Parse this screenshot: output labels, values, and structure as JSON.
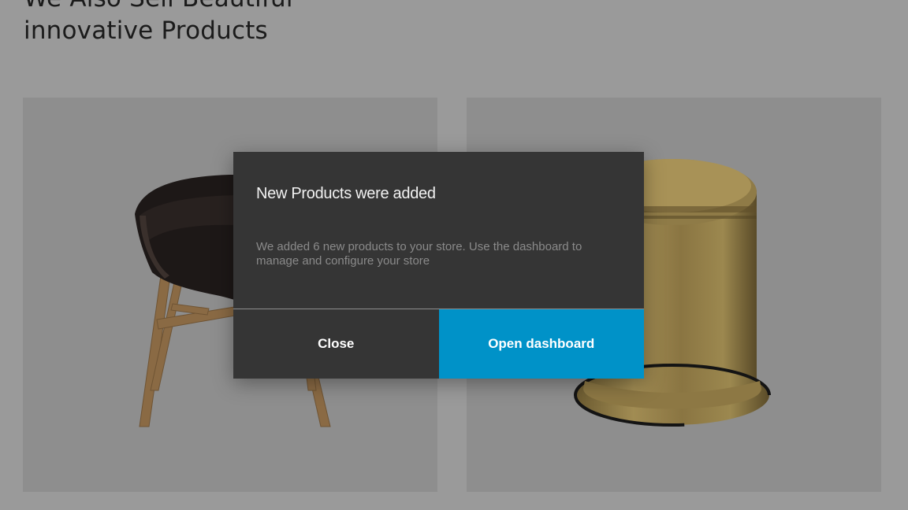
{
  "page": {
    "heading_line1": "We Also Sell Beautiful",
    "heading_line2": "innovative Products"
  },
  "products": [
    {
      "name": "chair-image"
    },
    {
      "name": "brass-stool-image"
    }
  ],
  "modal": {
    "title": "New Products were added",
    "body": "We added 6 new products to your store. Use the dashboard to manage and configure your store",
    "close_label": "Close",
    "primary_label": "Open dashboard"
  },
  "colors": {
    "overlay_background": "#9a9a9a",
    "modal_background": "#353535",
    "primary_button": "#0092c8"
  }
}
